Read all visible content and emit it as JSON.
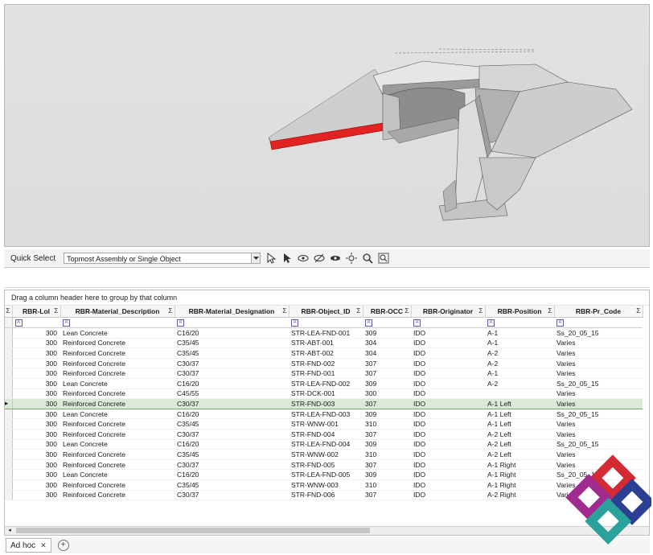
{
  "toolbar": {
    "quick_select_label": "Quick Select",
    "quick_select_value": "Topmost Assembly or Single Object",
    "icons": [
      "select-arrow-icon",
      "pointer-icon",
      "show-icon",
      "hide-icon",
      "visibility-icon",
      "light-icon",
      "zoom-icon",
      "zoom-fit-icon"
    ]
  },
  "grid": {
    "group_hint": "Drag a column header here to group by that column",
    "columns": [
      {
        "label": "RBR-Lol"
      },
      {
        "label": "RBR-Material_Description"
      },
      {
        "label": "RBR-Material_Designation"
      },
      {
        "label": "RBR-Object_ID"
      },
      {
        "label": "RBR-OCC"
      },
      {
        "label": "RBR-Originator"
      },
      {
        "label": "RBR-Position"
      },
      {
        "label": "RBR-Pr_Code"
      }
    ],
    "sigma": "Σ",
    "filter_glyph": "A",
    "rows": [
      [
        "300",
        "Lean Concrete",
        "C16/20",
        "STR-LEA-FND-001",
        "309",
        "IDO",
        "A-1",
        "Ss_20_05_15"
      ],
      [
        "300",
        "Reinforced Concrete",
        "C35/45",
        "STR-ABT-001",
        "304",
        "IDO",
        "A-1",
        "Varies"
      ],
      [
        "300",
        "Reinforced Concrete",
        "C35/45",
        "STR-ABT-002",
        "304",
        "IDO",
        "A-2",
        "Varies"
      ],
      [
        "300",
        "Reinforced Concrete",
        "C30/37",
        "STR-FND-002",
        "307",
        "IDO",
        "A-2",
        "Varies"
      ],
      [
        "300",
        "Reinforced Concrete",
        "C30/37",
        "STR-FND-001",
        "307",
        "IDO",
        "A-1",
        "Varies"
      ],
      [
        "300",
        "Lean Concrete",
        "C16/20",
        "STR-LEA-FND-002",
        "309",
        "IDO",
        "A-2",
        "Ss_20_05_15"
      ],
      [
        "300",
        "Reinforced Concrete",
        "C45/55",
        "STR-DCK-001",
        "300",
        "IDO",
        "",
        "Varies"
      ],
      [
        "300",
        "Reinforced Concrete",
        "C30/37",
        "STR-FND-003",
        "307",
        "IDO",
        "A-1 Left",
        "Varies"
      ],
      [
        "300",
        "Lean Concrete",
        "C16/20",
        "STR-LEA-FND-003",
        "309",
        "IDO",
        "A-1 Left",
        "Ss_20_05_15"
      ],
      [
        "300",
        "Reinforced Concrete",
        "C35/45",
        "STR-WNW-001",
        "310",
        "IDO",
        "A-1 Left",
        "Varies"
      ],
      [
        "300",
        "Reinforced Concrete",
        "C30/37",
        "STR-FND-004",
        "307",
        "IDO",
        "A-2 Left",
        "Varies"
      ],
      [
        "300",
        "Lean Concrete",
        "C16/20",
        "STR-LEA-FND-004",
        "309",
        "IDO",
        "A-2 Left",
        "Ss_20_05_15"
      ],
      [
        "300",
        "Reinforced Concrete",
        "C35/45",
        "STR-WNW-002",
        "310",
        "IDO",
        "A-2 Left",
        "Varies"
      ],
      [
        "300",
        "Reinforced Concrete",
        "C30/37",
        "STR-FND-005",
        "307",
        "IDO",
        "A-1 Right",
        "Varies"
      ],
      [
        "300",
        "Lean Concrete",
        "C16/20",
        "STR-LEA-FND-005",
        "309",
        "IDO",
        "A-1 Right",
        "Ss_20_05_15"
      ],
      [
        "300",
        "Reinforced Concrete",
        "C35/45",
        "STR-WNW-003",
        "310",
        "IDO",
        "A-1 Right",
        "Varies"
      ],
      [
        "300",
        "Reinforced Concrete",
        "C30/37",
        "STR-FND-006",
        "307",
        "IDO",
        "A-2 Right",
        "Varies"
      ]
    ],
    "current_row": 7
  },
  "tabs": [
    {
      "label": "Ad hoc",
      "close": "✕"
    }
  ],
  "add_tab_glyph": "+",
  "colors": {
    "highlight_object": "#e32222",
    "current_row_bg": "#dbe9d7",
    "logo_red": "#d42a34",
    "logo_blue": "#2b3f93",
    "logo_purple": "#a12c8f",
    "logo_teal": "#2aa19a"
  }
}
